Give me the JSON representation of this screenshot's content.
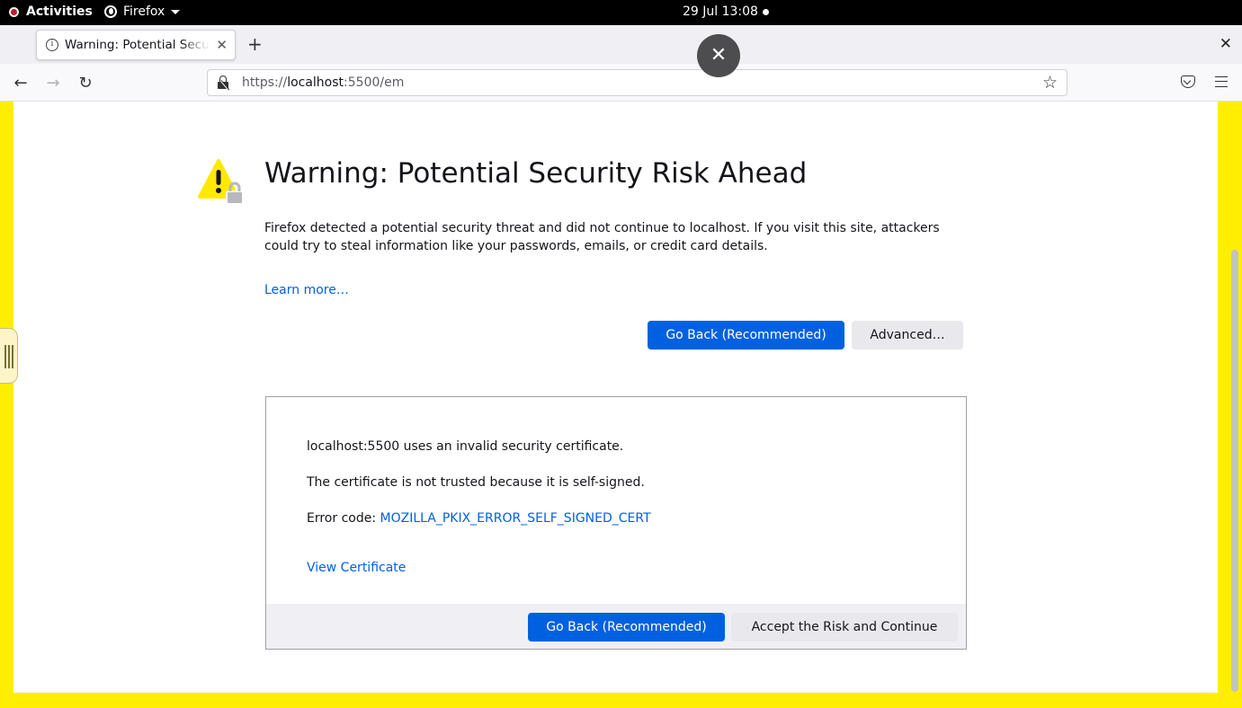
{
  "system": {
    "activities_label": "Activities",
    "app_menu_label": "Firefox",
    "clock": "29 Jul  13:08"
  },
  "tab": {
    "title": "Warning: Potential Security Risk Ahead",
    "close_glyph": "✕",
    "new_tab_glyph": "+"
  },
  "window": {
    "close_glyph": "✕"
  },
  "toolbar": {
    "back_glyph": "←",
    "forward_glyph": "→",
    "reload_glyph": "↻",
    "bookmark_glyph": "☆"
  },
  "urlbar": {
    "scheme": "https://",
    "host": "localhost",
    "rest": ":5500/em"
  },
  "overlay": {
    "close_glyph": "✕"
  },
  "error_page": {
    "title": "Warning: Potential Security Risk Ahead",
    "description": "Firefox detected a potential security threat and did not continue to localhost. If you visit this site, attackers could try to steal information like your passwords, emails, or credit card details.",
    "learn_more": "Learn more…",
    "go_back_label": "Go Back (Recommended)",
    "advanced_label": "Advanced…"
  },
  "advanced_panel": {
    "line1": "localhost:5500 uses an invalid security certificate.",
    "line2": "The certificate is not trusted because it is self-signed.",
    "error_code_prefix": "Error code: ",
    "error_code": "MOZILLA_PKIX_ERROR_SELF_SIGNED_CERT",
    "view_certificate": "View Certificate",
    "go_back_label": "Go Back (Recommended)",
    "accept_label": "Accept the Risk and Continue"
  },
  "colors": {
    "accent": "#0061e0",
    "frame_border": "#ffee00",
    "warning_yellow": "#ffe900"
  }
}
